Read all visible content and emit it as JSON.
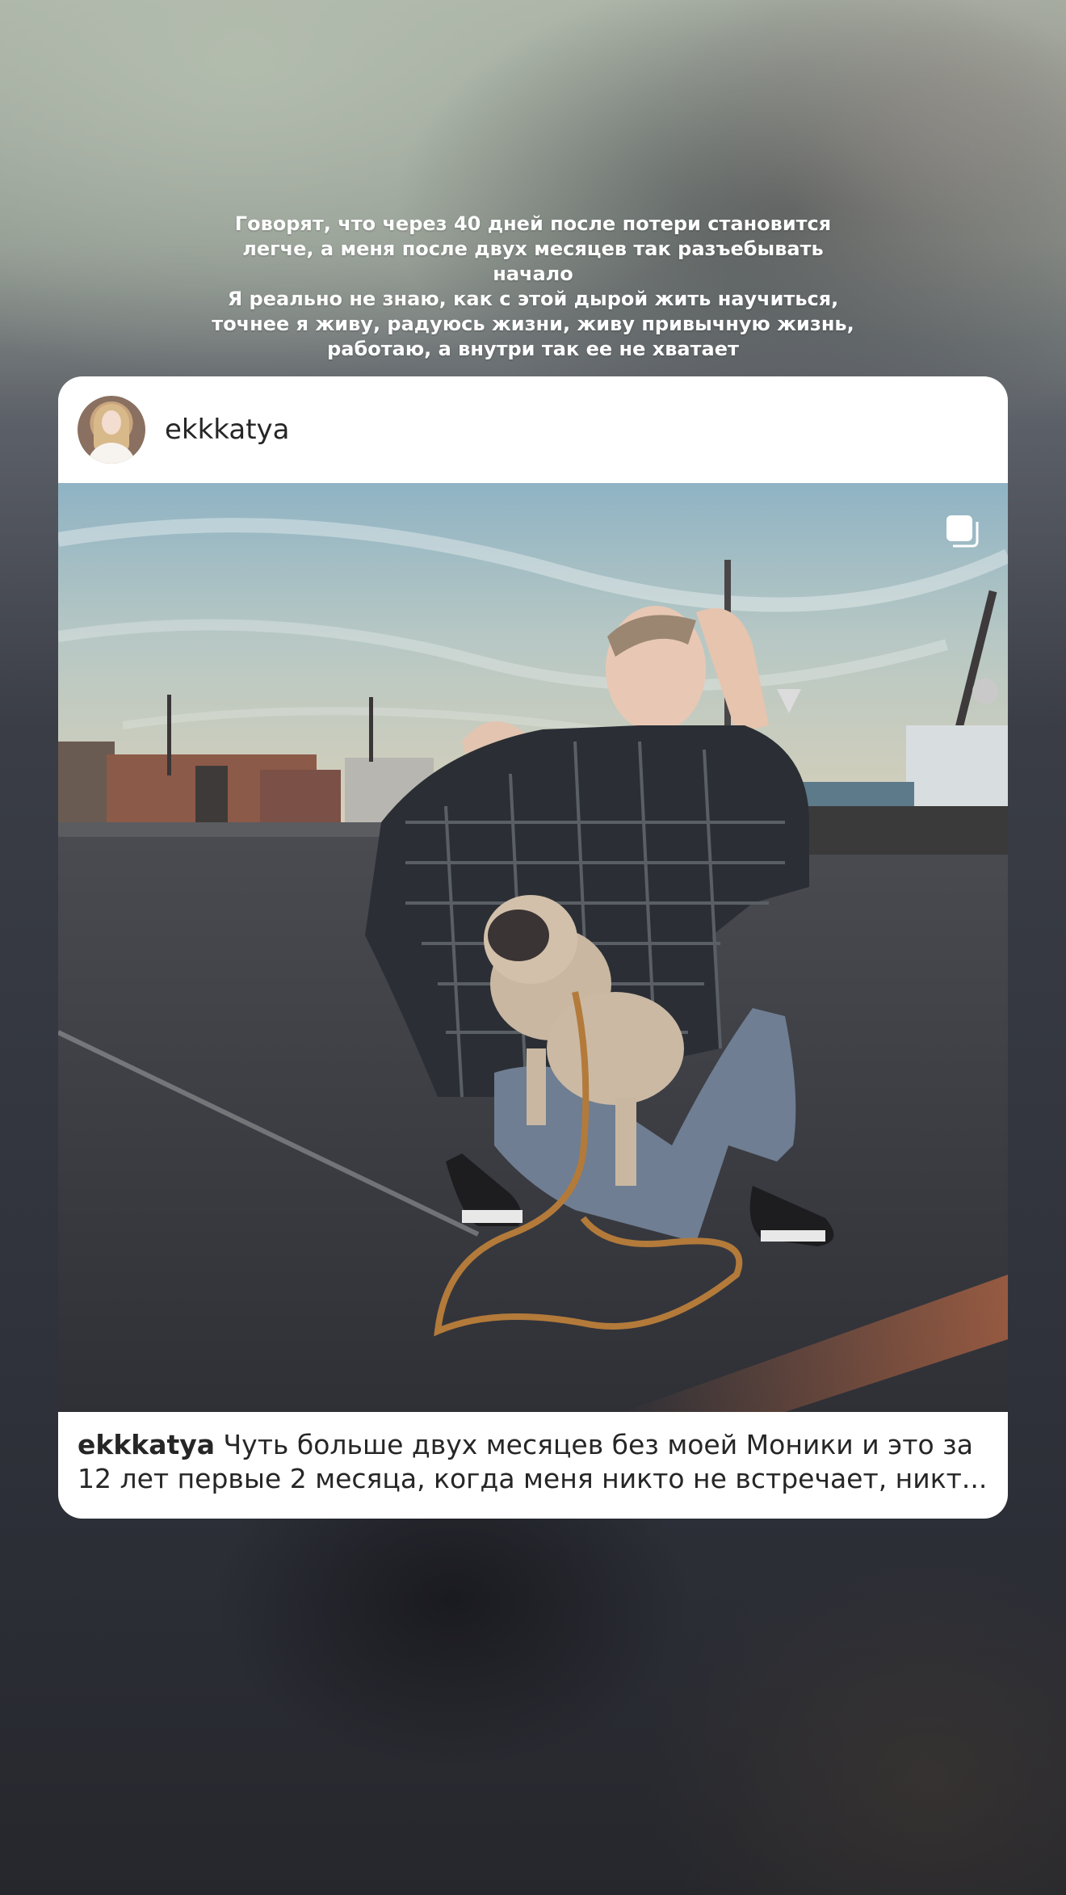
{
  "story": {
    "text_lines": [
      "Говорят, что через 40 дней после потери становится",
      "легче, а меня после двух месяцев так разъебывать",
      "начало",
      "Я реально не знаю, как с этой дырой жить научиться,",
      "точнее я живу, радуюсь жизни, живу привычную жизнь,",
      "работаю, а внутри так ее не хватает"
    ]
  },
  "post": {
    "username": "ekkkatya",
    "caption_user": "ekkkatya",
    "caption_line1": "Чуть больше двух месяцев без моей Моники и это за",
    "caption_line2": "12 лет первые 2 месяца, когда меня никто не встречает, никт...",
    "multi_icon": "carousel-icon"
  }
}
